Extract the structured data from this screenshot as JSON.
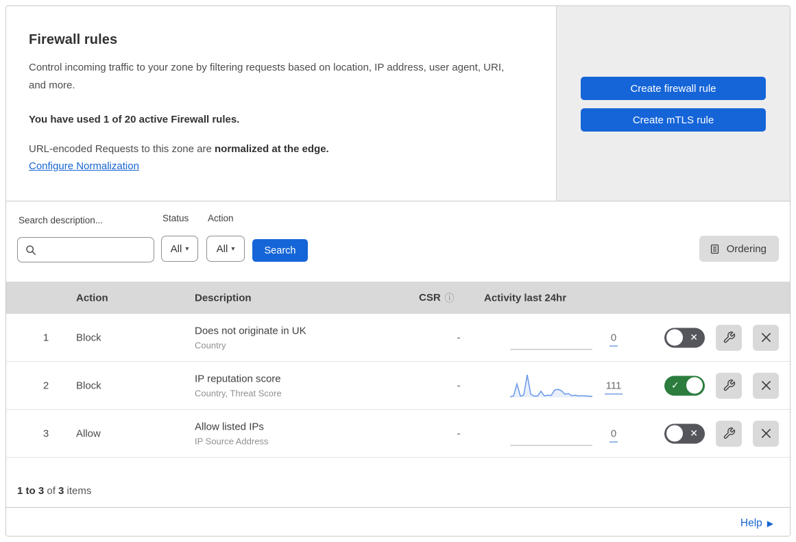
{
  "header": {
    "title": "Firewall rules",
    "description": "Control incoming traffic to your zone by filtering requests based on location, IP address, user agent, URI, and more.",
    "usage": "You have used 1 of 20 active Firewall rules.",
    "normalization_prefix": "URL-encoded Requests to this zone are ",
    "normalization_bold": "normalized at the edge.",
    "normalization_link": "Configure Normalization",
    "create_firewall_button": "Create firewall rule",
    "create_mtls_button": "Create mTLS rule"
  },
  "filters": {
    "search_label": "Search description...",
    "search_value": "",
    "status_label": "Status",
    "status_value": "All",
    "action_label": "Action",
    "action_value": "All",
    "search_button": "Search",
    "ordering_button": "Ordering"
  },
  "table": {
    "headers": {
      "action": "Action",
      "description": "Description",
      "csr": "CSR",
      "activity": "Activity last 24hr"
    },
    "rows": [
      {
        "number": "1",
        "action": "Block",
        "description": "Does not originate in UK",
        "fields": "Country",
        "csr": "-",
        "activity_count": "0",
        "enabled": false,
        "activity_series": []
      },
      {
        "number": "2",
        "action": "Block",
        "description": "IP reputation score",
        "fields": "Country, Threat Score",
        "csr": "-",
        "activity_count": "111",
        "enabled": true,
        "activity_series": [
          3,
          6,
          55,
          5,
          10,
          92,
          14,
          5,
          6,
          25,
          6,
          9,
          8,
          30,
          33,
          27,
          13,
          16,
          7,
          9,
          6,
          7,
          6,
          5,
          4
        ]
      },
      {
        "number": "3",
        "action": "Allow",
        "description": "Allow listed IPs",
        "fields": "IP Source Address",
        "csr": "-",
        "activity_count": "0",
        "enabled": false,
        "activity_series": []
      }
    ]
  },
  "footer": {
    "range_bold": "1 to 3",
    "of_text": " of ",
    "total_bold": "3",
    "items_text": " items",
    "help_label": "Help"
  },
  "icons": {
    "dropdown_arrow": "▾",
    "info": "ⓘ",
    "check": "✓",
    "cross": "✕",
    "help_arrow": "▶"
  },
  "colors": {
    "accent_blue": "#1565d8",
    "link_blue": "#1765d1",
    "toggle_on_green": "#2c7c3e",
    "toggle_off_gray": "#55555c",
    "sparkline_blue": "#6f9ceb",
    "table_header_gray": "#d9d9d9",
    "panel_gray": "#ededed"
  }
}
